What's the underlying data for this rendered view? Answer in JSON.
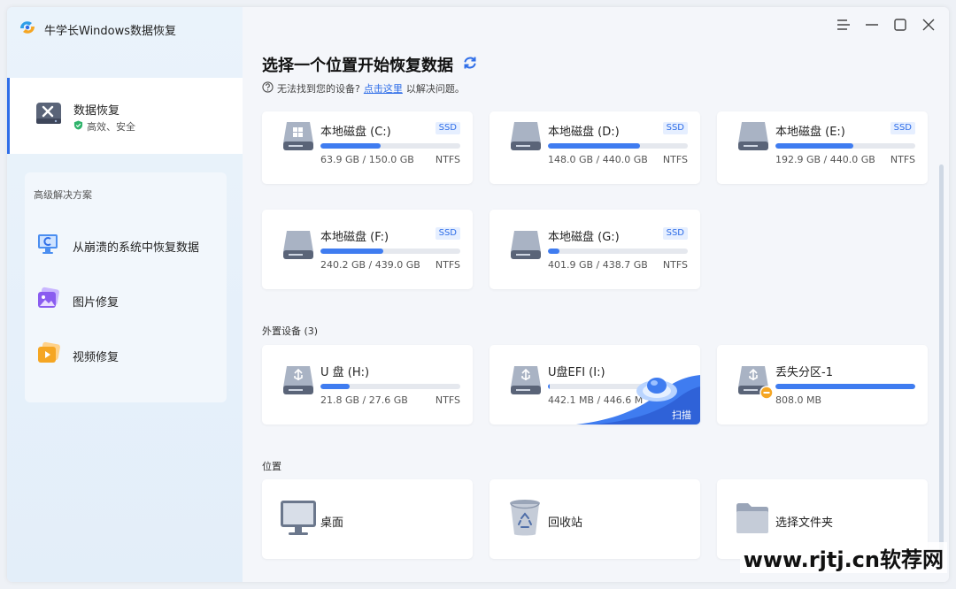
{
  "app": {
    "title": "牛学长Windows数据恢复"
  },
  "sidebar": {
    "active": {
      "title": "数据恢复",
      "sub": "高效、安全"
    },
    "advanced": {
      "title": "高级解决方案",
      "items": [
        {
          "label": "从崩溃的系统中恢复数据",
          "icon": "system-crash-icon"
        },
        {
          "label": "图片修复",
          "icon": "photo-repair-icon"
        },
        {
          "label": "视频修复",
          "icon": "video-repair-icon"
        }
      ]
    }
  },
  "main": {
    "title": "选择一个位置开始恢复数据",
    "hint_pre": "无法找到您的设备?",
    "hint_link": "点击这里",
    "hint_post": "以解决问题。"
  },
  "local_drives": [
    {
      "name": "本地磁盘 (C:)",
      "badge": "SSD",
      "size": "63.9 GB / 150.0 GB",
      "fs": "NTFS",
      "used": 0.43,
      "system": true
    },
    {
      "name": "本地磁盘 (D:)",
      "badge": "SSD",
      "size": "148.0 GB / 440.0 GB",
      "fs": "NTFS",
      "used": 0.66
    },
    {
      "name": "本地磁盘 (E:)",
      "badge": "SSD",
      "size": "192.9 GB / 440.0 GB",
      "fs": "NTFS",
      "used": 0.56
    },
    {
      "name": "本地磁盘 (F:)",
      "badge": "SSD",
      "size": "240.2 GB / 439.0 GB",
      "fs": "NTFS",
      "used": 0.45
    },
    {
      "name": "本地磁盘 (G:)",
      "badge": "SSD",
      "size": "401.9 GB / 438.7 GB",
      "fs": "NTFS",
      "used": 0.08
    }
  ],
  "external": {
    "label": "外置设备 (3)",
    "drives": [
      {
        "name": "U 盘 (H:)",
        "size": "21.8 GB / 27.6 GB",
        "fs": "NTFS",
        "used": 0.21
      },
      {
        "name": "U盘EFI (I:)",
        "size": "442.1 MB / 446.6 M",
        "fs": "",
        "used": 0.01,
        "scan": "扫描"
      },
      {
        "name": "丢失分区-1",
        "size": "808.0 MB",
        "fs": "",
        "used": 1.0,
        "lost": true
      }
    ]
  },
  "locations": {
    "label": "位置",
    "items": [
      {
        "label": "桌面",
        "icon": "desktop-icon"
      },
      {
        "label": "回收站",
        "icon": "recycle-bin-icon"
      },
      {
        "label": "选择文件夹",
        "icon": "folder-icon"
      }
    ]
  },
  "watermark": "www.rjtj.cn软荐网"
}
